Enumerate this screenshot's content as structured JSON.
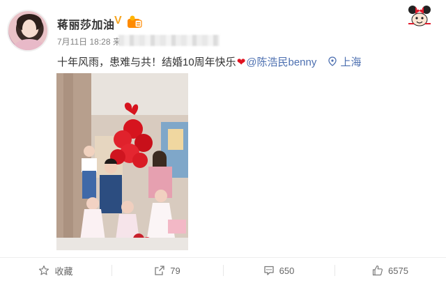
{
  "post": {
    "username": "蒋丽莎加油",
    "verified_mark": "V",
    "time": "7月11日 18:28 来",
    "text": "十年风雨，患难与共！结婚10周年快乐",
    "mention": "@陈浩民benny",
    "location": "上海"
  },
  "actions": {
    "favorite_label": "收藏",
    "repost_count": "79",
    "comment_count": "650",
    "like_count": "6575"
  },
  "colors": {
    "link": "#4c6fb0",
    "heart": "#e0121f",
    "verified": "#f6a623"
  },
  "icons": [
    "star-icon",
    "share-icon",
    "comment-icon",
    "thumbs-up-icon",
    "location-icon",
    "heart-icon",
    "minnie-icon"
  ]
}
